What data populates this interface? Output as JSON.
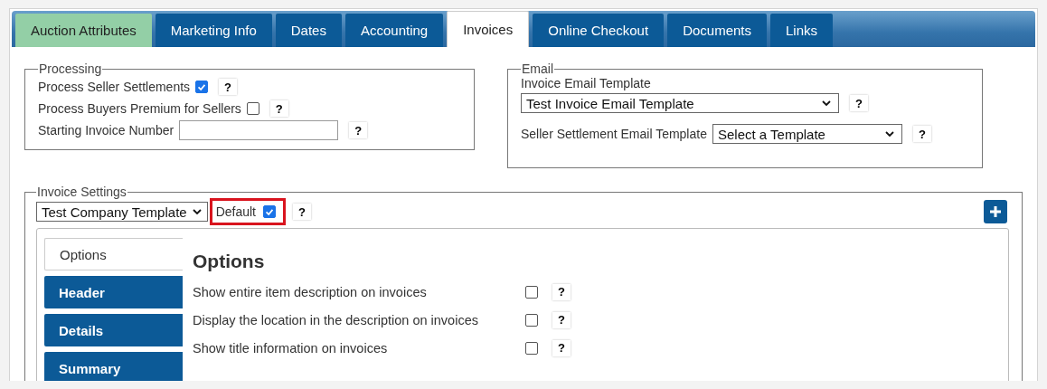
{
  "tabs": [
    {
      "label": "Auction Attributes",
      "selected": false,
      "color": "#93cfa6"
    },
    {
      "label": "Marketing Info",
      "selected": false,
      "color": "#0c5a97"
    },
    {
      "label": "Dates",
      "selected": false,
      "color": "#0c5a97"
    },
    {
      "label": "Accounting",
      "selected": false,
      "color": "#0c5a97"
    },
    {
      "label": "Invoices",
      "selected": true,
      "color": "#ffffff"
    },
    {
      "label": "Online Checkout",
      "selected": false,
      "color": "#0c5a97"
    },
    {
      "label": "Documents",
      "selected": false,
      "color": "#0c5a97"
    },
    {
      "label": "Links",
      "selected": false,
      "color": "#0c5a97"
    }
  ],
  "processing": {
    "legend": "Processing",
    "rows": [
      {
        "kind": "checkbox",
        "label": "Process Seller Settlements",
        "checked": true,
        "help": "?"
      },
      {
        "kind": "checkbox",
        "label": "Process Buyers Premium for Sellers",
        "checked": false,
        "help": "?"
      },
      {
        "kind": "text",
        "label": "Starting Invoice Number",
        "help": "?"
      }
    ]
  },
  "email": {
    "legend": "Email",
    "invoice_template": {
      "label": "Invoice Email Template",
      "value": "Test Invoice Email Template",
      "help": "?"
    },
    "seller_template": {
      "label": "Seller Settlement Email Template",
      "value": "Select a Template",
      "help": "?"
    }
  },
  "invoice_settings": {
    "legend": "Invoice Settings",
    "template": "Test Company Template",
    "default": {
      "label": "Default",
      "checked": true,
      "highlighted": true,
      "help": "?"
    },
    "side_tabs": [
      {
        "label": "Options",
        "selected": true
      },
      {
        "label": "Header",
        "selected": false
      },
      {
        "label": "Details",
        "selected": false
      },
      {
        "label": "Summary",
        "selected": false
      }
    ],
    "heading": "Options",
    "options": [
      {
        "label": "Show entire item description on invoices",
        "checked": false,
        "help": "?"
      },
      {
        "label": "Display the location in the description on invoices",
        "checked": false,
        "help": "?"
      },
      {
        "label": "Show title information on invoices",
        "checked": false,
        "help": "?"
      }
    ]
  }
}
